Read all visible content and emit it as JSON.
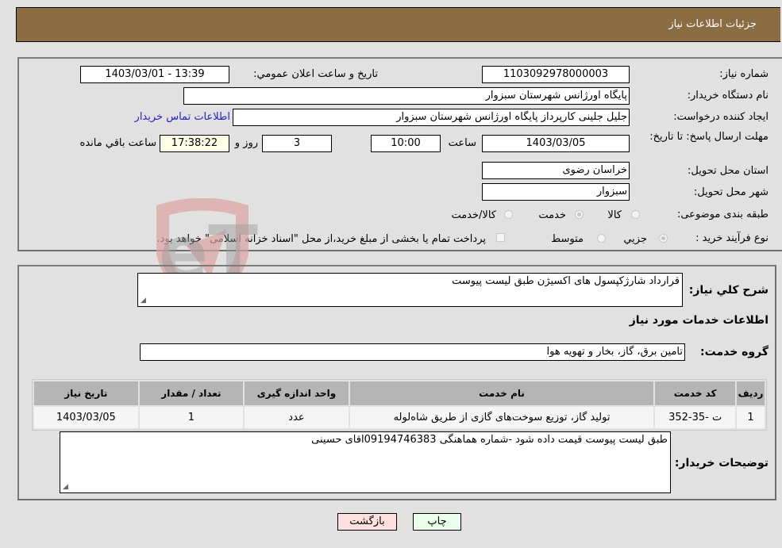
{
  "header": {
    "title": "جزئیات اطلاعات نیاز"
  },
  "form": {
    "need_number": {
      "label": "شماره نیاز:",
      "value": "1103092978000003"
    },
    "announce_datetime": {
      "label": "تاریخ و ساعت اعلان عمومي:",
      "value": "1403/03/01 - 13:39"
    },
    "buyer_org": {
      "label": "نام دستگاه خريدار:",
      "value": "پایگاه اورژانس شهرستان سبزوار"
    },
    "requester": {
      "label": "ایجاد کننده درخواست:",
      "value": "جلیل جلینی کارپرداز پایگاه اورژانس شهرستان سبزوار"
    },
    "contact_link": "اطلاعات تماس خریدار",
    "deadline": {
      "label": "مهلت ارسال پاسخ: تا تاریخ:",
      "date": "1403/03/05",
      "time_label": "ساعت",
      "time": "10:00",
      "days": "3",
      "days_label": "روز و",
      "remaining": "17:38:22",
      "remaining_label": "ساعت باقي مانده"
    },
    "province": {
      "label": "استان محل تحویل:",
      "value": "خراسان رضوی"
    },
    "city": {
      "label": "شهر محل تحویل:",
      "value": "سبزوار"
    },
    "category": {
      "label": "طبقه بندی موضوعی:",
      "options": [
        "کالا",
        "خدمت",
        "کالا/خدمت"
      ],
      "selected": "خدمت"
    },
    "purchase_type": {
      "label": "نوع فرآیند خرید :",
      "options": [
        "جزيي",
        "متوسط"
      ],
      "selected": "جزيي",
      "treasury_checkbox": "پرداخت تمام یا بخشی از مبلغ خرید،از محل \"اسناد خزانه اسلامی\" خواهد بود.",
      "treasury_checked": false
    }
  },
  "details": {
    "summary_label": "شرح کلي نیاز:",
    "summary_value": "قرارداد شارژکپسول های اکسیژن طبق لیست پیوست",
    "services_heading": "اطلاعات خدمات مورد نیاز",
    "service_group_label": "گروه خدمت:",
    "service_group_value": "تامین برق، گاز، بخار و تهویه هوا",
    "table": {
      "headers": [
        "ردیف",
        "کد خدمت",
        "نام خدمت",
        "واحد اندازه گیری",
        "تعداد / مقدار",
        "تاریخ نیاز"
      ],
      "rows": [
        [
          "1",
          "ت -35-352",
          "تولید گاز، توزیع سوخت‌های گازی از طریق شاه‌لوله",
          "عدد",
          "1",
          "1403/03/05"
        ]
      ]
    },
    "buyer_notes_label": "توضیحات خریدار:",
    "buyer_notes_value": "طبق لیست پیوست قیمت داده شود -شماره هماهنگی 09194746383اقای حسینی"
  },
  "buttons": {
    "print": "چاپ",
    "back": "بازگشت"
  },
  "watermark": {
    "text": "AriaTender.neT"
  },
  "colors": {
    "header_bg": "#8c6c41",
    "print_bg": "#eaffea",
    "back_bg": "#ffe0e0",
    "link": "#2222cc"
  }
}
